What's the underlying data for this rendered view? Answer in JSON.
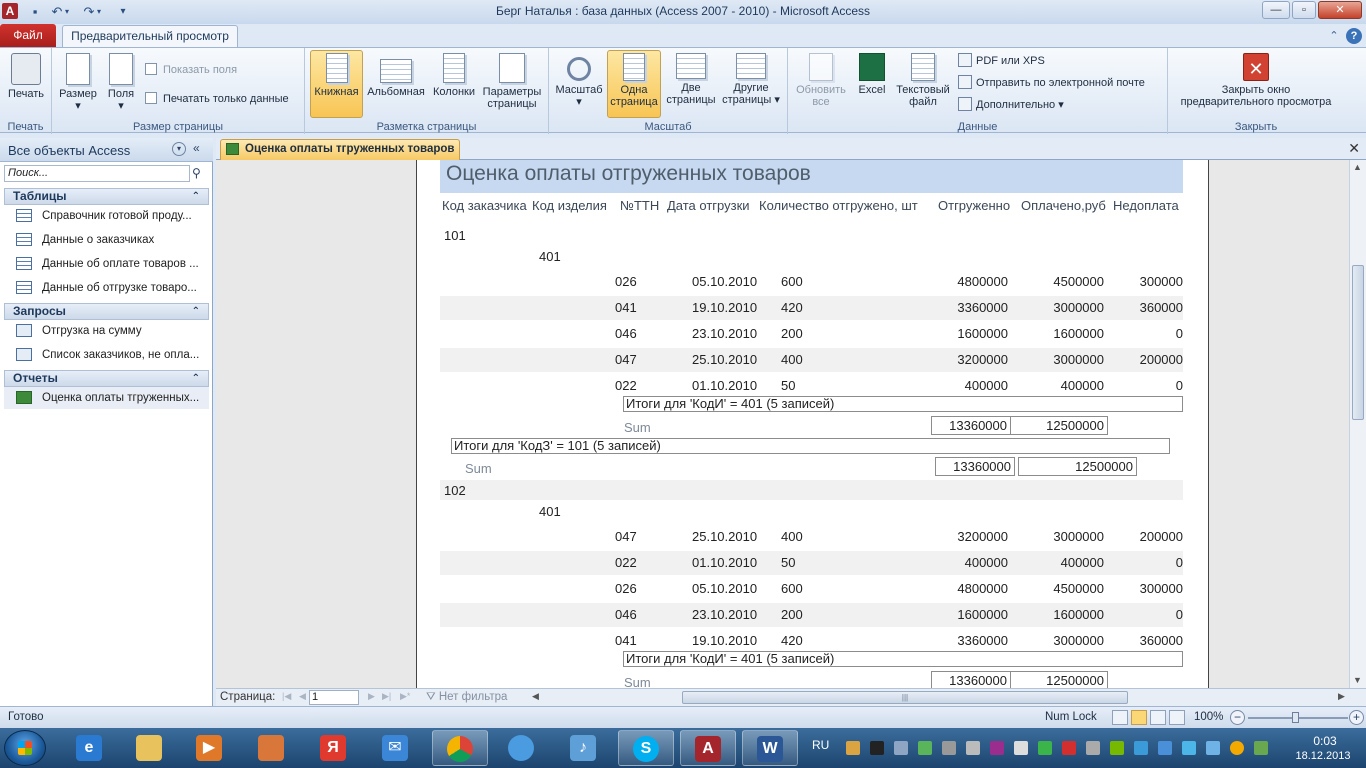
{
  "window": {
    "title": "Берг Наталья : база данных (Access 2007 - 2010)  -  Microsoft Access",
    "app_icon": "A",
    "controls": {
      "minimize": "—",
      "maximize": "▫",
      "close": "✕"
    }
  },
  "ribbon_tabs": {
    "file": "Файл",
    "preview": "Предварительный просмотр"
  },
  "ribbon": {
    "print_group": {
      "label": "Печать",
      "print": "Печать"
    },
    "page_size_group": {
      "label": "Размер страницы",
      "size": "Размер",
      "margins": "Поля",
      "show_margins": "Показать поля",
      "print_data_only": "Печатать только данные"
    },
    "page_layout_group": {
      "label": "Разметка страницы",
      "portrait": "Книжная",
      "landscape": "Альбомная",
      "columns": "Колонки",
      "page_setup_line1": "Параметры",
      "page_setup_line2": "страницы"
    },
    "zoom_group": {
      "label": "Масштаб",
      "zoom": "Масштаб",
      "one_page_line1": "Одна",
      "one_page_line2": "страница",
      "two_pages_line1": "Две",
      "two_pages_line2": "страницы",
      "more_pages_line1": "Другие",
      "more_pages_line2": "страницы"
    },
    "data_group": {
      "label": "Данные",
      "refresh_line1": "Обновить",
      "refresh_line2": "все",
      "excel": "Excel",
      "text_file_line1": "Текстовый",
      "text_file_line2": "файл",
      "pdf_xps": "PDF или XPS",
      "email": "Отправить по электронной почте",
      "more": "Дополнительно"
    },
    "close_group": {
      "label": "Закрыть",
      "close_line1": "Закрыть окно",
      "close_line2": "предварительного просмотра"
    }
  },
  "nav_pane": {
    "title": "Все объекты Access",
    "search_placeholder": "Поиск...",
    "sections": [
      {
        "label": "Таблицы",
        "items": [
          "Справочник готовой проду...",
          "Данные о заказчиках",
          "Данные об оплате товаров ...",
          "Данные об отгрузке товаро..."
        ]
      },
      {
        "label": "Запросы",
        "items": [
          "Отгрузка на сумму",
          "Список заказчиков, не опла..."
        ]
      },
      {
        "label": "Отчеты",
        "items": [
          "Оценка оплаты тгруженных..."
        ]
      }
    ]
  },
  "document_tab": "Оценка оплаты тгруженных товаров",
  "report": {
    "title": "Оценка оплаты отгруженных товаров",
    "columns": [
      "Код заказчика",
      "Код изделия",
      "№ТТН",
      "Дата отгрузки",
      "Количество отгружено, шт",
      "Отгруженно",
      "Оплачено,руб",
      "Недоплата"
    ],
    "group1": {
      "customer": "101",
      "product": "401",
      "rows": [
        [
          "026",
          "05.10.2010",
          "600",
          "4800000",
          "4500000",
          "300000"
        ],
        [
          "041",
          "19.10.2010",
          "420",
          "3360000",
          "3000000",
          "360000"
        ],
        [
          "046",
          "23.10.2010",
          "200",
          "1600000",
          "1600000",
          "0"
        ],
        [
          "047",
          "25.10.2010",
          "400",
          "3200000",
          "3000000",
          "200000"
        ],
        [
          "022",
          "01.10.2010",
          "50",
          "400000",
          "400000",
          "0"
        ]
      ],
      "product_summary": "Итоги для 'КодИ' =  401 (5 записей)",
      "product_sum_label": "Sum",
      "product_sum_shipped": "13360000",
      "product_sum_paid": "12500000",
      "customer_summary": "Итоги для 'КодЗ' =  101 (5 записей)",
      "customer_sum_label": "Sum",
      "customer_sum_shipped": "13360000",
      "customer_sum_paid": "12500000"
    },
    "group2": {
      "customer": "102",
      "product": "401",
      "rows": [
        [
          "047",
          "25.10.2010",
          "400",
          "3200000",
          "3000000",
          "200000"
        ],
        [
          "022",
          "01.10.2010",
          "50",
          "400000",
          "400000",
          "0"
        ],
        [
          "026",
          "05.10.2010",
          "600",
          "4800000",
          "4500000",
          "300000"
        ],
        [
          "046",
          "23.10.2010",
          "200",
          "1600000",
          "1600000",
          "0"
        ],
        [
          "041",
          "19.10.2010",
          "420",
          "3360000",
          "3000000",
          "360000"
        ]
      ],
      "product_summary": "Итоги для 'КодИ' =  401 (5 записей)",
      "product_sum_label": "Sum",
      "product_sum_shipped": "13360000",
      "product_sum_paid": "12500000"
    }
  },
  "page_nav": {
    "label": "Страница:",
    "page": "1",
    "filter": "Нет фильтра"
  },
  "status": {
    "ready": "Готово",
    "num_lock": "Num Lock",
    "zoom": "100%"
  },
  "taskbar": {
    "language": "RU",
    "time": "0:03",
    "date": "18.12.2013"
  },
  "colors": {
    "accent": "#f7c964",
    "report_title_band": "#c6d9f1",
    "file_tab": "#c52a25"
  }
}
